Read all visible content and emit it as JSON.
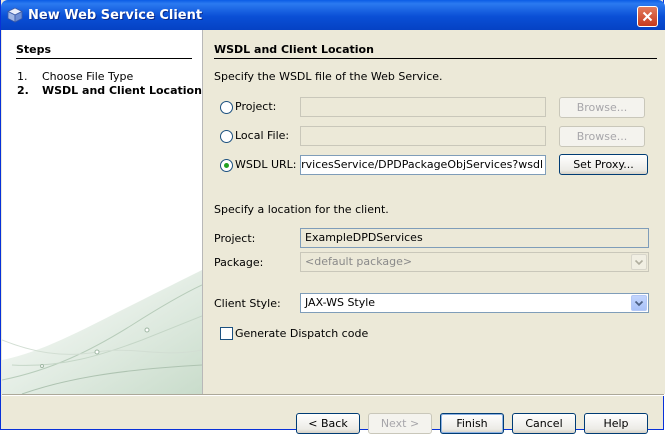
{
  "window": {
    "title": "New Web Service Client"
  },
  "steps": {
    "heading": "Steps",
    "items": [
      {
        "num": "1.",
        "label": "Choose File Type"
      },
      {
        "num": "2.",
        "label": "WSDL and Client Location"
      }
    ]
  },
  "main": {
    "heading": "WSDL and Client Location",
    "wsdl_instruction": "Specify the WSDL file of the Web Service.",
    "project_label": "Project:",
    "local_file_label": "Local File:",
    "wsdl_url_label": "WSDL URL:",
    "browse_label": "Browse...",
    "wsdl_url_value": "ObjServicesService/DPDPackageObjServices?wsdl",
    "set_proxy_label": "Set Proxy...",
    "location_instruction": "Specify a location for the client.",
    "client_project_label": "Project:",
    "client_project_value": "ExampleDPDServices",
    "package_label": "Package:",
    "package_placeholder": "<default package>",
    "client_style_label": "Client Style:",
    "client_style_value": "JAX-WS Style",
    "dispatch_label": "Generate Dispatch code"
  },
  "buttons": {
    "back": "< Back",
    "next": "Next >",
    "finish": "Finish",
    "cancel": "Cancel",
    "help": "Help"
  }
}
